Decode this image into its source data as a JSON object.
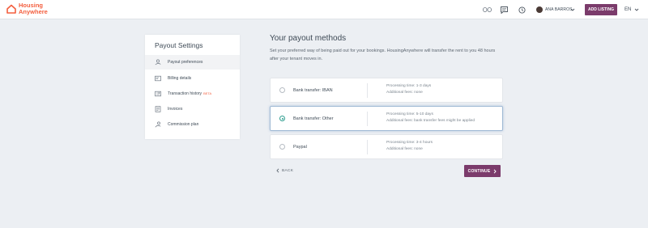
{
  "header": {
    "logo_line1": "Housing",
    "logo_line2": "Anywhere",
    "user_name": "ANA BARROS",
    "add_listing_label": "ADD LISTING",
    "language": "EN"
  },
  "sidebar": {
    "title": "Payout Settings",
    "items": [
      {
        "label": "Payout preferences",
        "icon": "hand-coin-icon",
        "active": true
      },
      {
        "label": "Billing details",
        "icon": "billing-card-icon",
        "active": false
      },
      {
        "label": "Transaction history",
        "badge": "BETA",
        "icon": "transaction-history-icon",
        "active": false
      },
      {
        "label": "Invoices",
        "icon": "invoice-icon",
        "active": false
      },
      {
        "label": "Commission plan",
        "icon": "commission-icon",
        "active": false
      }
    ]
  },
  "main": {
    "title": "Your payout methods",
    "description": "Set your preferred way of being paid out for your bookings. HousingAnywhere will transfer the rent to you 48 hours after your tenant moves in.",
    "methods": [
      {
        "name": "Bank transfer: IBAN",
        "processing": "Processing time: 1-3 days",
        "fees": "Additional fees: none",
        "selected": false
      },
      {
        "name": "Bank transfer: Other",
        "processing": "Processing time: 5-10 days",
        "fees": "Additional fees: bank transfer fees might be applied",
        "selected": true
      },
      {
        "name": "Paypal",
        "processing": "Processing time: 3-4 hours",
        "fees": "Additional fees: none",
        "selected": false
      }
    ],
    "back_label": "BACK",
    "continue_label": "CONTINUE"
  },
  "colors": {
    "brand": "#f35e3e",
    "primary_button": "#7b3b6b",
    "radio_selected": "#2f9e8f"
  }
}
